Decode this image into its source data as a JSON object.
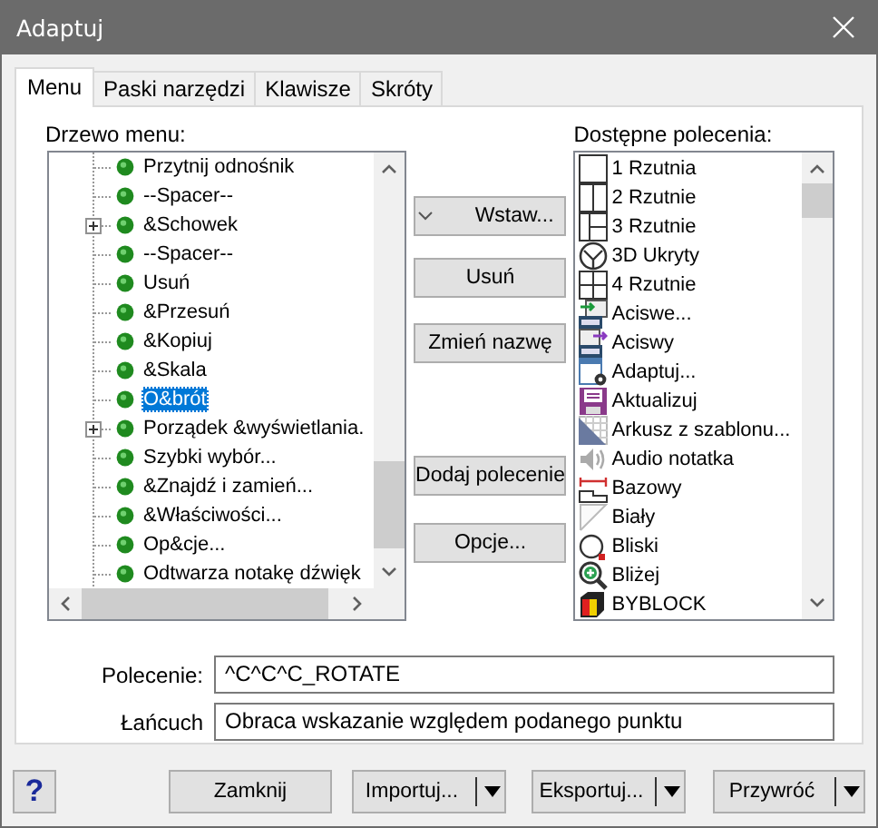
{
  "window": {
    "title": "Adaptuj"
  },
  "tabs": [
    {
      "label": "Menu",
      "selected": true
    },
    {
      "label": "Paski narzędzi",
      "selected": false
    },
    {
      "label": "Klawisze",
      "selected": false
    },
    {
      "label": "Skróty",
      "selected": false
    }
  ],
  "menu_tree": {
    "label": "Drzewo menu:",
    "items": [
      {
        "label": "Przytnij odnośnik",
        "expandable": false,
        "selected": false
      },
      {
        "label": "--Spacer--",
        "expandable": false,
        "selected": false
      },
      {
        "label": "&Schowek",
        "expandable": true,
        "selected": false
      },
      {
        "label": "--Spacer--",
        "expandable": false,
        "selected": false
      },
      {
        "label": "Usuń",
        "expandable": false,
        "selected": false
      },
      {
        "label": "&Przesuń",
        "expandable": false,
        "selected": false
      },
      {
        "label": "&Kopiuj",
        "expandable": false,
        "selected": false
      },
      {
        "label": "&Skala",
        "expandable": false,
        "selected": false
      },
      {
        "label": "O&brót",
        "expandable": false,
        "selected": true
      },
      {
        "label": "Porządek &wyświetlania.",
        "expandable": true,
        "selected": false
      },
      {
        "label": "Szybki wybór...",
        "expandable": false,
        "selected": false
      },
      {
        "label": "&Znajdź i zamień...",
        "expandable": false,
        "selected": false
      },
      {
        "label": "&Właściwości...",
        "expandable": false,
        "selected": false
      },
      {
        "label": "Op&cje...",
        "expandable": false,
        "selected": false
      },
      {
        "label": "Odtwarza notakę dźwięk",
        "expandable": false,
        "selected": false
      }
    ]
  },
  "actions": [
    {
      "label": "Wstaw...",
      "kind": "dropdown"
    },
    {
      "label": "Usuń",
      "kind": "plain"
    },
    {
      "label": "Zmień nazwę",
      "kind": "plain"
    },
    {
      "label": "Dodaj polecenie",
      "kind": "plain"
    },
    {
      "label": "Opcje...",
      "kind": "plain"
    }
  ],
  "commands": {
    "label": "Dostępne polecenia:",
    "items": [
      {
        "label": "1 Rzutnia",
        "kind": "vp1"
      },
      {
        "label": "2 Rzutnie",
        "kind": "vp2"
      },
      {
        "label": "3 Rzutnie",
        "kind": "vp3"
      },
      {
        "label": "3D Ukryty",
        "kind": "hide"
      },
      {
        "label": "4 Rzutnie",
        "kind": "vp4"
      },
      {
        "label": "Aciswe...",
        "kind": "acisin"
      },
      {
        "label": "Aciswy",
        "kind": "acisout"
      },
      {
        "label": "Adaptuj...",
        "kind": "custom"
      },
      {
        "label": "Aktualizuj",
        "kind": "save"
      },
      {
        "label": "Arkusz z szablonu...",
        "kind": "sheet"
      },
      {
        "label": "Audio notatka",
        "kind": "audio"
      },
      {
        "label": "Bazowy",
        "kind": "base"
      },
      {
        "label": "Biały",
        "kind": "white"
      },
      {
        "label": "Bliski",
        "kind": "near"
      },
      {
        "label": "Bliżej",
        "kind": "zoom"
      },
      {
        "label": "BYBLOCK",
        "kind": "block"
      }
    ]
  },
  "fields": [
    {
      "label": "Polecenie:",
      "value": "^C^C^C_ROTATE"
    },
    {
      "label": "Łańcuch",
      "value": "Obraca wskazanie względem podanego punktu"
    }
  ],
  "footer": {
    "help": "?",
    "buttons": [
      {
        "label": "Zamknij",
        "kind": "plain"
      },
      {
        "label": "Importuj...",
        "kind": "split"
      },
      {
        "label": "Eksportuj...",
        "kind": "split"
      },
      {
        "label": "Przywróć",
        "kind": "split"
      }
    ]
  }
}
